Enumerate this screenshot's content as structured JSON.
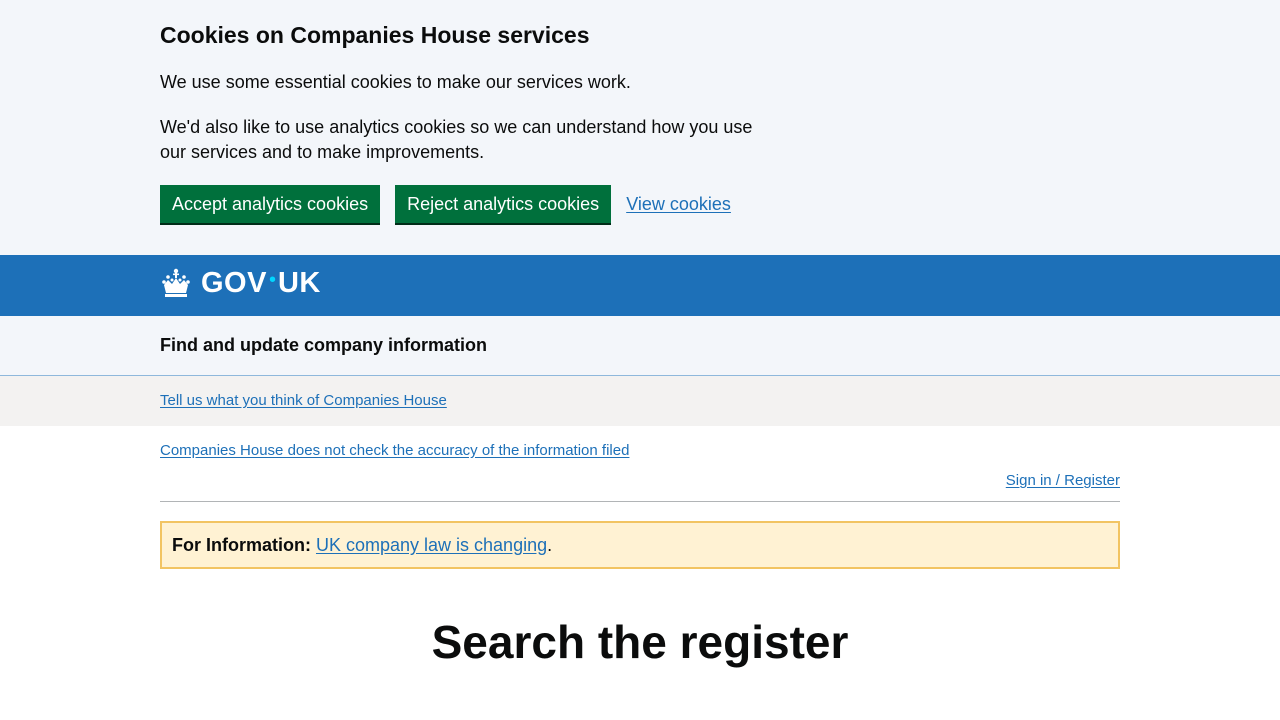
{
  "cookie_banner": {
    "title": "Cookies on Companies House services",
    "paragraph_1": "We use some essential cookies to make our services work.",
    "paragraph_2": "We'd also like to use analytics cookies so we can understand how you use our services and to make improvements.",
    "accept_label": "Accept analytics cookies",
    "reject_label": "Reject analytics cookies",
    "view_label": "View cookies"
  },
  "header": {
    "logo_left": "GOV",
    "logo_dot": "•",
    "logo_right": "UK",
    "service_name": "Find and update company information"
  },
  "feedback": {
    "link": "Tell us what you think of Companies House"
  },
  "accuracy_link": "Companies House does not check the accuracy of the information filed",
  "sign_in_link": "Sign in / Register",
  "notice": {
    "strong": "For Information:",
    "link": "UK company law is changing",
    "suffix": "."
  },
  "main": {
    "heading": "Search the register"
  },
  "colors": {
    "brand_blue": "#1d70b8",
    "button_green": "#00703c",
    "notice_bg": "#fff2d3",
    "notice_border": "#f2c462"
  }
}
